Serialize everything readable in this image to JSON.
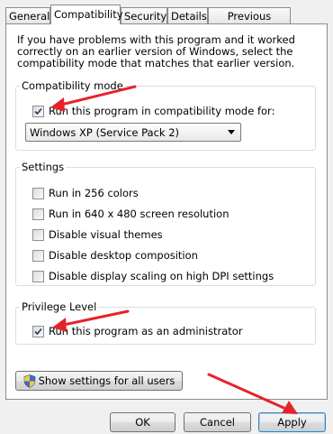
{
  "tabs": [
    {
      "label": "General",
      "active": false
    },
    {
      "label": "Compatibility",
      "active": true
    },
    {
      "label": "Security",
      "active": false
    },
    {
      "label": "Details",
      "active": false
    },
    {
      "label": "Previous Versions",
      "active": false
    }
  ],
  "intro_text": "If you have problems with this program and it worked correctly on an earlier version of Windows, select the compatibility mode that matches that earlier version.",
  "compat_mode": {
    "title": "Compatibility mode",
    "checkbox_label": "Run this program in compatibility mode for:",
    "checked": true,
    "selected_os": "Windows XP (Service Pack 2)"
  },
  "settings": {
    "title": "Settings",
    "items": [
      {
        "label": "Run in 256 colors",
        "checked": false
      },
      {
        "label": "Run in 640 x 480 screen resolution",
        "checked": false
      },
      {
        "label": "Disable visual themes",
        "checked": false
      },
      {
        "label": "Disable desktop composition",
        "checked": false
      },
      {
        "label": "Disable display scaling on high DPI settings",
        "checked": false
      }
    ]
  },
  "privilege": {
    "title": "Privilege Level",
    "checkbox_label": "Run this program as an administrator",
    "checked": true
  },
  "all_users_button": "Show settings for all users",
  "buttons": {
    "ok": "OK",
    "cancel": "Cancel",
    "apply": "Apply"
  },
  "colors": {
    "annotation_arrow": "#e5232b",
    "panel": "#ffffff",
    "dialog": "#f0f0f0"
  }
}
